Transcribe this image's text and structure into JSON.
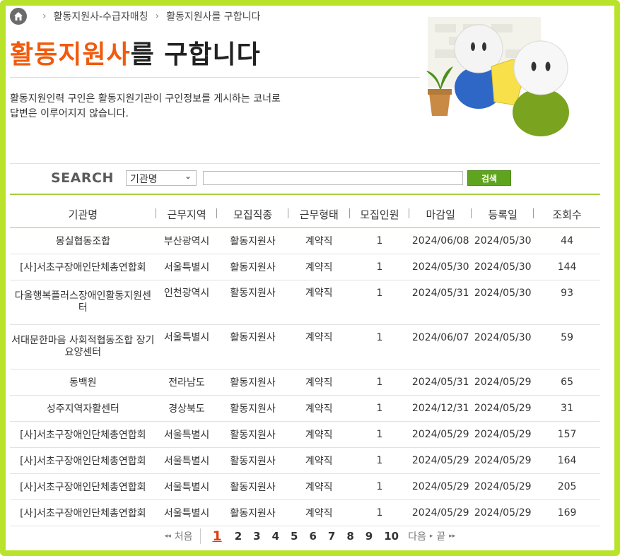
{
  "breadcrumb": [
    "활동지원사-수급자매칭",
    "활동지원사를 구합니다"
  ],
  "title": {
    "highlight": "활동지원사",
    "rest": "를 구합니다"
  },
  "description": [
    "활동지원인력 구인은 활동지원기관이 구인정보를 게시하는 코너로",
    "답변은 이루어지지 않습니다."
  ],
  "search": {
    "label": "SEARCH",
    "selected": "기관명",
    "value": "",
    "button": "검색"
  },
  "table": {
    "headers": [
      "기관명",
      "근무지역",
      "모집직종",
      "근무형태",
      "모집인원",
      "마감일",
      "등록일",
      "조회수"
    ],
    "rows": [
      [
        "몽실협동조합",
        "부산광역시",
        "활동지원사",
        "계약직",
        "1",
        "2024/06/08",
        "2024/05/30",
        "44"
      ],
      [
        "[사]서초구장애인단체총연합회",
        "서울특별시",
        "활동지원사",
        "계약직",
        "1",
        "2024/05/30",
        "2024/05/30",
        "144"
      ],
      [
        "다울행복플러스장애인활동지원센터",
        "인천광역시",
        "활동지원사",
        "계약직",
        "1",
        "2024/05/31",
        "2024/05/30",
        "93"
      ],
      [
        "서대문한마음 사회적협동조합 장기요양센터",
        "서울특별시",
        "활동지원사",
        "계약직",
        "1",
        "2024/06/07",
        "2024/05/30",
        "59"
      ],
      [
        "동백원",
        "전라남도",
        "활동지원사",
        "계약직",
        "1",
        "2024/05/31",
        "2024/05/29",
        "65"
      ],
      [
        "성주지역자활센터",
        "경상북도",
        "활동지원사",
        "계약직",
        "1",
        "2024/12/31",
        "2024/05/29",
        "31"
      ],
      [
        "[사]서초구장애인단체총연합회",
        "서울특별시",
        "활동지원사",
        "계약직",
        "1",
        "2024/05/29",
        "2024/05/29",
        "157"
      ],
      [
        "[사]서초구장애인단체총연합회",
        "서울특별시",
        "활동지원사",
        "계약직",
        "1",
        "2024/05/29",
        "2024/05/29",
        "164"
      ],
      [
        "[사]서초구장애인단체총연합회",
        "서울특별시",
        "활동지원사",
        "계약직",
        "1",
        "2024/05/29",
        "2024/05/29",
        "205"
      ],
      [
        "[사]서초구장애인단체총연합회",
        "서울특별시",
        "활동지원사",
        "계약직",
        "1",
        "2024/05/29",
        "2024/05/29",
        "169"
      ]
    ]
  },
  "pagination": {
    "first": "처음",
    "current": "1",
    "pages": [
      "2",
      "3",
      "4",
      "5",
      "6",
      "7",
      "8",
      "9",
      "10"
    ],
    "next": "다음",
    "last": "끝"
  },
  "colors": {
    "accent": "#f25a0c",
    "frame": "#b9e32a",
    "button": "#5fa41f"
  }
}
